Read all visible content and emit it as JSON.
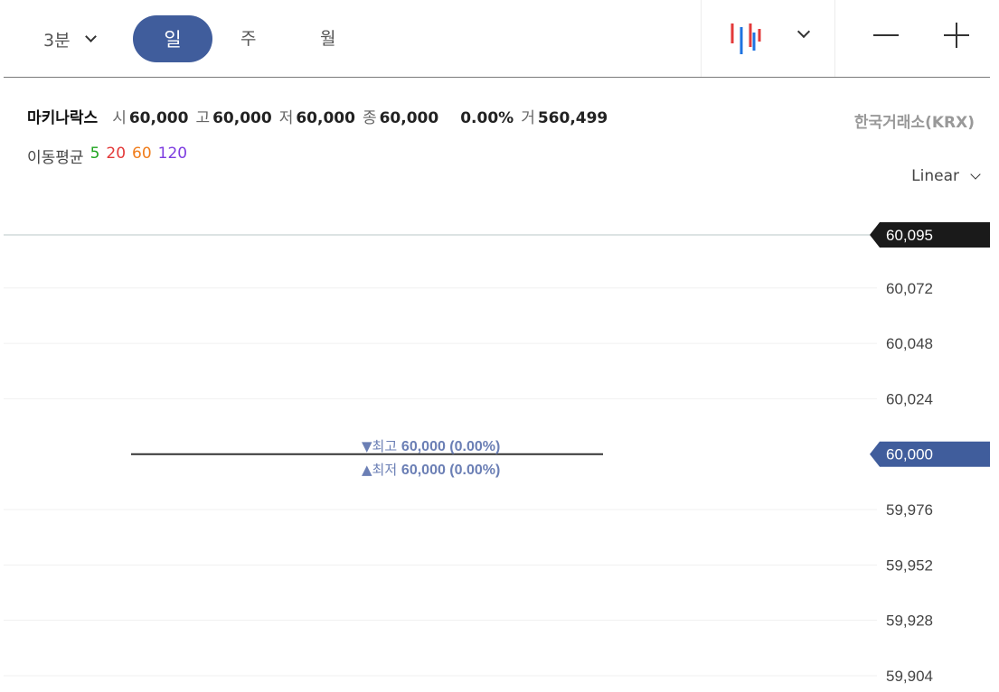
{
  "toolbar": {
    "interval_3m": "3분",
    "tab_day": "일",
    "tab_week": "주",
    "tab_month": "월"
  },
  "info": {
    "name": "마키나락스",
    "open_label": "시",
    "open": "60,000",
    "high_label": "고",
    "high": "60,000",
    "low_label": "저",
    "low": "60,000",
    "close_label": "종",
    "close": "60,000",
    "change_pct": "0.00%",
    "volume_label": "거",
    "volume": "560,499",
    "exchange": "한국거래소(KRX)"
  },
  "moving_average": {
    "label": "이동평균",
    "p5": "5",
    "p20": "20",
    "p60": "60",
    "p120": "120",
    "colors": {
      "p5": "#1fa51f",
      "p20": "#e33a3a",
      "p60": "#f07d1c",
      "p120": "#7d3ce0"
    }
  },
  "scale_mode": "Linear",
  "annotations": {
    "high_prefix": "▼최고",
    "high_text": "60,000 (0.00%)",
    "low_prefix": "▲최저",
    "low_text": "60,000 (0.00%)"
  },
  "colors": {
    "accent": "#405d9c",
    "current_price_tag": "#405d9c",
    "crosshair_tag": "#1a1a1a"
  },
  "chart_data": {
    "type": "line",
    "x_days": [
      1,
      2
    ],
    "values": [
      60000,
      60000
    ],
    "ylim": [
      59904,
      60095
    ],
    "y_ticks": [
      60072,
      60048,
      60024,
      59976,
      59952,
      59928,
      59904
    ],
    "y_tick_labels": [
      "60,072",
      "60,048",
      "60,024",
      "59,976",
      "59,952",
      "59,928",
      "59,904"
    ],
    "crosshair": {
      "value": 60095,
      "label": "60,095"
    },
    "current": {
      "value": 60000,
      "label": "60,000"
    },
    "grid": true
  }
}
